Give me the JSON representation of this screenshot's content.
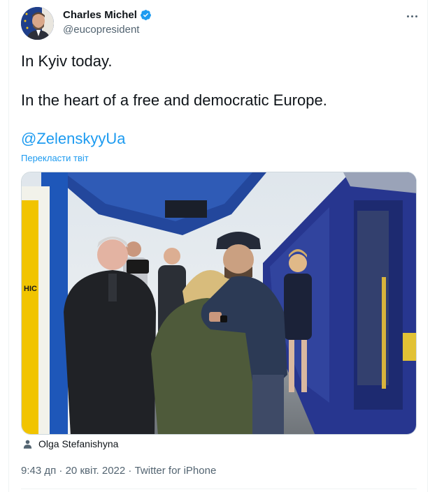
{
  "tweet": {
    "author": {
      "display_name": "Charles Michel",
      "handle": "@eucopresident",
      "verified": true,
      "verified_icon": "verified-badge-icon"
    },
    "more_icon": "more-options-icon",
    "text_line1": "In Kyiv today.",
    "text_line2": "In the heart of a free and democratic Europe.",
    "mention": "@ZelenskyyUa",
    "translate_label": "Перекласти твіт",
    "photo_tag": "Olga Stefanishyna",
    "photo_tag_icon": "person-icon",
    "time": "9:43 дп",
    "date": "20 квіт. 2022",
    "source": "Twitter for iPhone",
    "separator": "·"
  },
  "colors": {
    "link": "#1d9bf0",
    "text": "#0f1419",
    "secondary": "#536471",
    "divider": "#eff3f4"
  }
}
